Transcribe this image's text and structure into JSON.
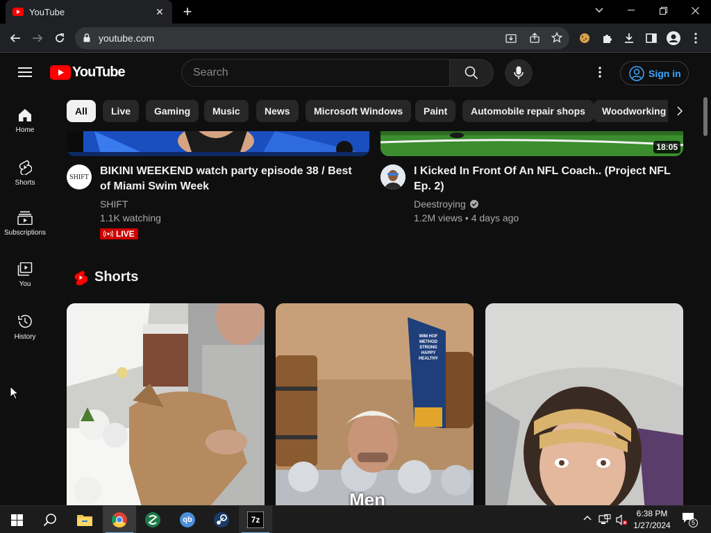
{
  "browser": {
    "tab_title": "YouTube",
    "url": "youtube.com"
  },
  "youtube": {
    "logo_text": "YouTube",
    "search_placeholder": "Search",
    "sign_in": "Sign in"
  },
  "sidebar": {
    "items": [
      {
        "label": "Home",
        "icon": "home-icon"
      },
      {
        "label": "Shorts",
        "icon": "shorts-icon"
      },
      {
        "label": "Subscriptions",
        "icon": "subscriptions-icon"
      },
      {
        "label": "You",
        "icon": "you-icon"
      },
      {
        "label": "History",
        "icon": "history-icon"
      }
    ]
  },
  "chips": [
    "All",
    "Live",
    "Gaming",
    "Music",
    "News",
    "Microsoft Windows",
    "Paint",
    "Automobile repair shops",
    "Woodworking"
  ],
  "videos": [
    {
      "title": "BIKINI WEEKEND watch party episode 38 / Best of Miami Swim Week",
      "channel": "SHIFT",
      "stats": "1.1K watching",
      "badge": "LIVE",
      "avatar_text": "SHIFT"
    },
    {
      "title": "I Kicked In Front Of An NFL Coach.. (Project NFL Ep. 2)",
      "channel": "Deestroying",
      "stats": "1.2M views • 4 days ago",
      "duration": "18:05"
    }
  ],
  "shorts": {
    "heading": "Shorts",
    "items": [
      {
        "caption": ""
      },
      {
        "caption": "Men",
        "sign_text": "WIM HOF METHOD\nSTRONG HAPPY HEALTHY"
      },
      {
        "caption": ""
      }
    ]
  },
  "taskbar": {
    "time": "6:38 PM",
    "date": "1/27/2024",
    "notification_count": "5",
    "apps": [
      "file-explorer",
      "chrome",
      "app-green",
      "qbittorrent",
      "steam",
      "7zip"
    ],
    "app_7zip_label": "7z",
    "app_qb_label": "qb"
  },
  "colors": {
    "youtube_red": "#ff0000",
    "link_blue": "#3ea6ff",
    "live_red": "#cc0000"
  }
}
